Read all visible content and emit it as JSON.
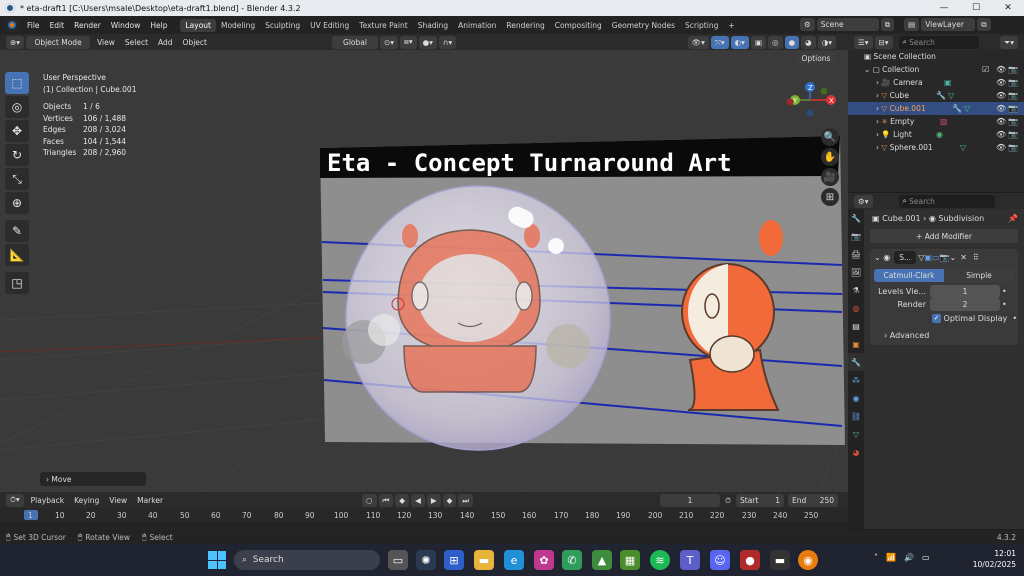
{
  "window": {
    "title": "* eta-draft1 [C:\\Users\\msale\\Desktop\\eta-draft1.blend] - Blender 4.3.2"
  },
  "menubar": {
    "menus": [
      "File",
      "Edit",
      "Render",
      "Window",
      "Help"
    ],
    "workspaces": [
      "Layout",
      "Modeling",
      "Sculpting",
      "UV Editing",
      "Texture Paint",
      "Shading",
      "Animation",
      "Rendering",
      "Compositing",
      "Geometry Nodes",
      "Scripting"
    ],
    "add_tab": "+",
    "scene_label": "Scene",
    "viewlayer_label": "ViewLayer"
  },
  "viewport_header": {
    "mode": "Object Mode",
    "menus": [
      "View",
      "Select",
      "Add",
      "Object"
    ],
    "orientation": "Global"
  },
  "viewport": {
    "perspective": "User Perspective",
    "collection_path": "(1) Collection | Cube.001",
    "stats": [
      {
        "label": "Objects",
        "value": "1 / 6"
      },
      {
        "label": "Vertices",
        "value": "106 / 1,488"
      },
      {
        "label": "Edges",
        "value": "208 / 3,024"
      },
      {
        "label": "Faces",
        "value": "104 / 1,544"
      },
      {
        "label": "Triangles",
        "value": "208 / 2,960"
      }
    ],
    "options_label": "Options",
    "canvas_title": "Eta - Concept Turnaround Art",
    "gizmo_axes": {
      "x": "X",
      "y": "Y",
      "z": "Z"
    },
    "last_operator": "Move"
  },
  "timeline": {
    "menus": [
      "Playback",
      "Keying",
      "View",
      "Marker"
    ],
    "current_frame": "1",
    "start_label": "Start",
    "start_value": "1",
    "end_label": "End",
    "end_value": "250",
    "ruler": [
      "1",
      "10",
      "20",
      "30",
      "40",
      "50",
      "60",
      "70",
      "80",
      "90",
      "100",
      "110",
      "120",
      "130",
      "140",
      "150",
      "160",
      "170",
      "180",
      "190",
      "200",
      "210",
      "220",
      "230",
      "240",
      "250"
    ]
  },
  "statusbar": {
    "hints": [
      "Set 3D Cursor",
      "Rotate View",
      "Select"
    ],
    "version": "4.3.2"
  },
  "outliner": {
    "search_placeholder": "Search",
    "root": "Scene Collection",
    "collection": "Collection",
    "items": [
      {
        "name": "Camera",
        "icon": "camera-icon"
      },
      {
        "name": "Cube",
        "icon": "mesh-icon"
      },
      {
        "name": "Cube.001",
        "icon": "mesh-icon",
        "selected": true
      },
      {
        "name": "Empty",
        "icon": "empty-icon"
      },
      {
        "name": "Light",
        "icon": "light-icon"
      },
      {
        "name": "Sphere.001",
        "icon": "mesh-icon"
      }
    ]
  },
  "properties": {
    "search_placeholder": "Search",
    "breadcrumb_object": "Cube.001",
    "breadcrumb_modifier": "Subdivision",
    "add_modifier": "Add Modifier",
    "modifier_name": "S...",
    "tabs": [
      "Catmull-Clark",
      "Simple"
    ],
    "levels_label": "Levels Vie...",
    "levels_value": "1",
    "render_label": "Render",
    "render_value": "2",
    "optimal_display": "Optimal Display",
    "advanced": "Advanced"
  },
  "taskbar": {
    "search_label": "Search",
    "time": "12:01",
    "date": "10/02/2025"
  },
  "colors": {
    "accent": "#4772b3",
    "selection": "#334d80",
    "blender_orange": "#e87d0d"
  }
}
